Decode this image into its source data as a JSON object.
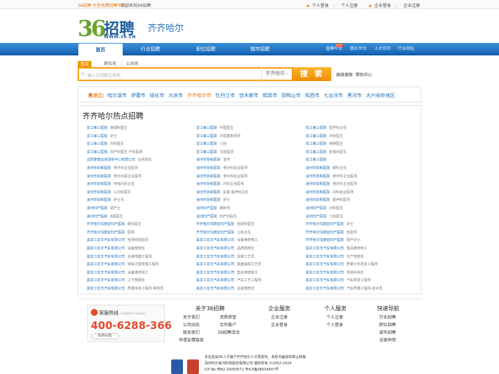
{
  "topbar": {
    "slogan": "36招聘 大型免费招聘平台",
    "welcome": "欢迎来到36招聘",
    "person_login": "个人登录",
    "person_register": "个人注册",
    "company_login": "企业登录",
    "company_register": "企业注册"
  },
  "logo": {
    "num": "36",
    "text": "招聘",
    "www": "WWW.36.CN"
  },
  "city_title": "齐齐哈尔",
  "nav": {
    "items": [
      "首页",
      "行业招聘",
      "职位招聘",
      "城市招聘"
    ],
    "sub": [
      "直聘平台",
      "猎头平台",
      "人才存存",
      "行业网址"
    ],
    "hot_badge": "HOT"
  },
  "search": {
    "tabs": [
      "全文",
      "职位名",
      "公司名"
    ],
    "placeholder": "输入公司职位名称",
    "city": "齐齐哈尔",
    "button": "搜 索",
    "advanced": "高级搜索",
    "help": "帮助中心"
  },
  "province": {
    "name": "黑龙江:",
    "cities": [
      "哈尔滨市",
      "伊春市",
      "绥化市",
      "大庆市",
      "齐齐哈尔市",
      "牡丹江市",
      "佳木斯市",
      "鹤岗市",
      "双鸭山市",
      "鸡西市",
      "七台河市",
      "黑河市",
      "大兴安岭地区"
    ],
    "current_index": 4
  },
  "hot": {
    "title": "齐齐哈尔热点招聘",
    "columns": [
      [
        {
          "co": "龙江第三医院",
          "pos": "病理科医生"
        },
        {
          "co": "龙江第三医院",
          "pos": "护士"
        },
        {
          "co": "龙江第三医院",
          "pos": "内科医生"
        },
        {
          "co": "龙江第三医院",
          "pos": "妇产科医生 产科医师"
        },
        {
          "co": "沈阳誉泰血液透析中心有限公司",
          "pos": "业务院长"
        },
        {
          "co": "讷河市协和医院",
          "pos": "骨外科主任医师"
        },
        {
          "co": "讷河市协和医院",
          "pos": "普外科副主任医师"
        },
        {
          "co": "讷河市协和医院",
          "pos": "呼吸内科主任"
        },
        {
          "co": "讷河市协和医院",
          "pos": "心内科医生"
        },
        {
          "co": "讷河市协和医院",
          "pos": "护士长"
        },
        {
          "co": "讷河妇产医院",
          "pos": "助产士"
        },
        {
          "co": "讷河妇产医院",
          "pos": "B超医生"
        },
        {
          "co": "齐齐哈尔玛丽亚妇产医院",
          "pos": "眼科医生"
        },
        {
          "co": "齐齐哈尔玛丽亚妇产医院",
          "pos": "医师"
        },
        {
          "co": "黑龙江龙华汽车有限公司",
          "pos": "检测线检验员"
        },
        {
          "co": "黑龙江龙华汽车有限公司",
          "pos": "设备部部长"
        },
        {
          "co": "黑龙江龙华汽车有限公司",
          "pos": "总装电器工程师"
        },
        {
          "co": "黑龙江龙华汽车有限公司",
          "pos": "特殊过程管理工程师"
        },
        {
          "co": "黑龙江龙华汽车有限公司",
          "pos": "设备维修钳工"
        },
        {
          "co": "黑龙江龙华汽车有限公司",
          "pos": "工艺部部长"
        },
        {
          "co": "黑龙江龙华汽车有限公司",
          "pos": "质量体系工程师-审核员"
        }
      ],
      [
        {
          "co": "龙江第三医院",
          "pos": "中医医生"
        },
        {
          "co": "龙江第三医院",
          "pos": "中医康复技师"
        },
        {
          "co": "龙江第三医院",
          "pos": "儿科"
        },
        {
          "co": "龙江第三医院",
          "pos": "住院医师"
        },
        {
          "co": "讷河市协和医院",
          "pos": "宣传"
        },
        {
          "co": "讷河市协和医院",
          "pos": "骨外科执业医师"
        },
        {
          "co": "讷河市协和医院",
          "pos": "普外科执业医师"
        },
        {
          "co": "讷河市协和医院",
          "pos": "内科主治医师"
        },
        {
          "co": "讷河市协和医院",
          "pos": "彩超 超声科主任"
        },
        {
          "co": "讷河市协和医院",
          "pos": "护士"
        },
        {
          "co": "讷河妇产医院",
          "pos": "麻醉师"
        },
        {
          "co": "讷河妇产医院",
          "pos": "妇产科医生"
        },
        {
          "co": "齐齐哈尔玛丽亚妇产医院",
          "pos": "检验科医生"
        },
        {
          "co": "齐齐哈尔玛丽亚妇产医院",
          "pos": "儿科主任"
        },
        {
          "co": "黑龙江龙华汽车有限公司",
          "pos": "设备维修电工"
        },
        {
          "co": "黑龙江龙华汽车有限公司",
          "pos": "品质部部长"
        },
        {
          "co": "黑龙江龙华汽车有限公司",
          "pos": "焊装工艺员"
        },
        {
          "co": "黑龙江龙华汽车有限公司",
          "pos": "底盘装配工艺员"
        },
        {
          "co": "黑龙江龙华汽车有限公司",
          "pos": "售后维修钳工"
        },
        {
          "co": "黑龙江龙华汽车有限公司",
          "pos": "汽车工艺工程师"
        },
        {
          "co": "黑龙江龙华汽车有限公司",
          "pos": "总装部部长"
        }
      ],
      [
        {
          "co": "龙江第三医院",
          "pos": "医学科主任"
        },
        {
          "co": "龙江第三医院",
          "pos": "外科医生"
        },
        {
          "co": "龙江第三医院",
          "pos": "麻醉医生"
        },
        {
          "co": "龙江第三医院",
          "pos": "影像科医生"
        },
        {
          "co": "龙江第三医院",
          "pos": ""
        },
        {
          "co": "讷河市协和医院",
          "pos": "眼科主任"
        },
        {
          "co": "讷河市协和医院",
          "pos": "骨外科主治医师"
        },
        {
          "co": "讷河市协和医院",
          "pos": "普外科主治医师"
        },
        {
          "co": "讷河市协和医院",
          "pos": "内科执业医师"
        },
        {
          "co": "讷河市协和医院",
          "pos": "超声科医师"
        },
        {
          "co": "讷河妇产医院",
          "pos": "内科医生"
        },
        {
          "co": "讷河妇产医院",
          "pos": "儿科医生"
        },
        {
          "co": "齐齐哈尔玛丽亚妇产医院",
          "pos": "护士"
        },
        {
          "co": "齐齐哈尔玛丽亚妇产医院",
          "pos": "检验师"
        },
        {
          "co": "齐齐哈尔玛丽亚妇产医院",
          "pos": "助产护士"
        },
        {
          "co": "黑龙江龙华汽车有限公司",
          "pos": "售后维修电工"
        },
        {
          "co": "黑龙江龙华汽车有限公司",
          "pos": "生产部部长"
        },
        {
          "co": "黑龙江龙华汽车有限公司",
          "pos": "质量分析改进工程师"
        },
        {
          "co": "黑龙江龙华汽车有限公司",
          "pos": "检验科科长"
        },
        {
          "co": "黑龙江龙华汽车有限公司",
          "pos": "汽车研发工程师"
        },
        {
          "co": "黑龙江龙华汽车有限公司",
          "pos": "汽车质量工程师-技术员"
        }
      ]
    ]
  },
  "footer": {
    "hotline_label": "客服热线",
    "hotline_en": "Customer Service",
    "hotline_number": "400-6288-366",
    "feedback": "有奖纠错",
    "about_title": "关于36招聘",
    "about_links": [
      "关于我们",
      "资质荣誉",
      "公司动态",
      "合作客户",
      "联系我们",
      "36招聘活动",
      "申请友情链接"
    ],
    "company_title": "企业服务",
    "company_links": [
      "企业注册",
      "企业登录"
    ],
    "person_title": "个人服务",
    "person_links": [
      "个人注册",
      "个人登录"
    ],
    "quick_title": "快速导航",
    "quick_links": [
      "行业招聘",
      "职位招聘",
      "城市招聘",
      "法律声明"
    ],
    "copyright_lines": [
      "本信息由36人才旗下齐齐哈尔人才网发布，未经书面授权禁止转载",
      "深圳市万易河科技股份有限公司 版权所有 ©2002-2024",
      "ICP No:粤B2-20050572  粤ICP备08034547号"
    ]
  },
  "colors": {
    "brand_blue": "#1766b6",
    "accent_orange": "#f39c12",
    "hot_red": "#e34a2f",
    "logo_green": "#6aa42f"
  }
}
